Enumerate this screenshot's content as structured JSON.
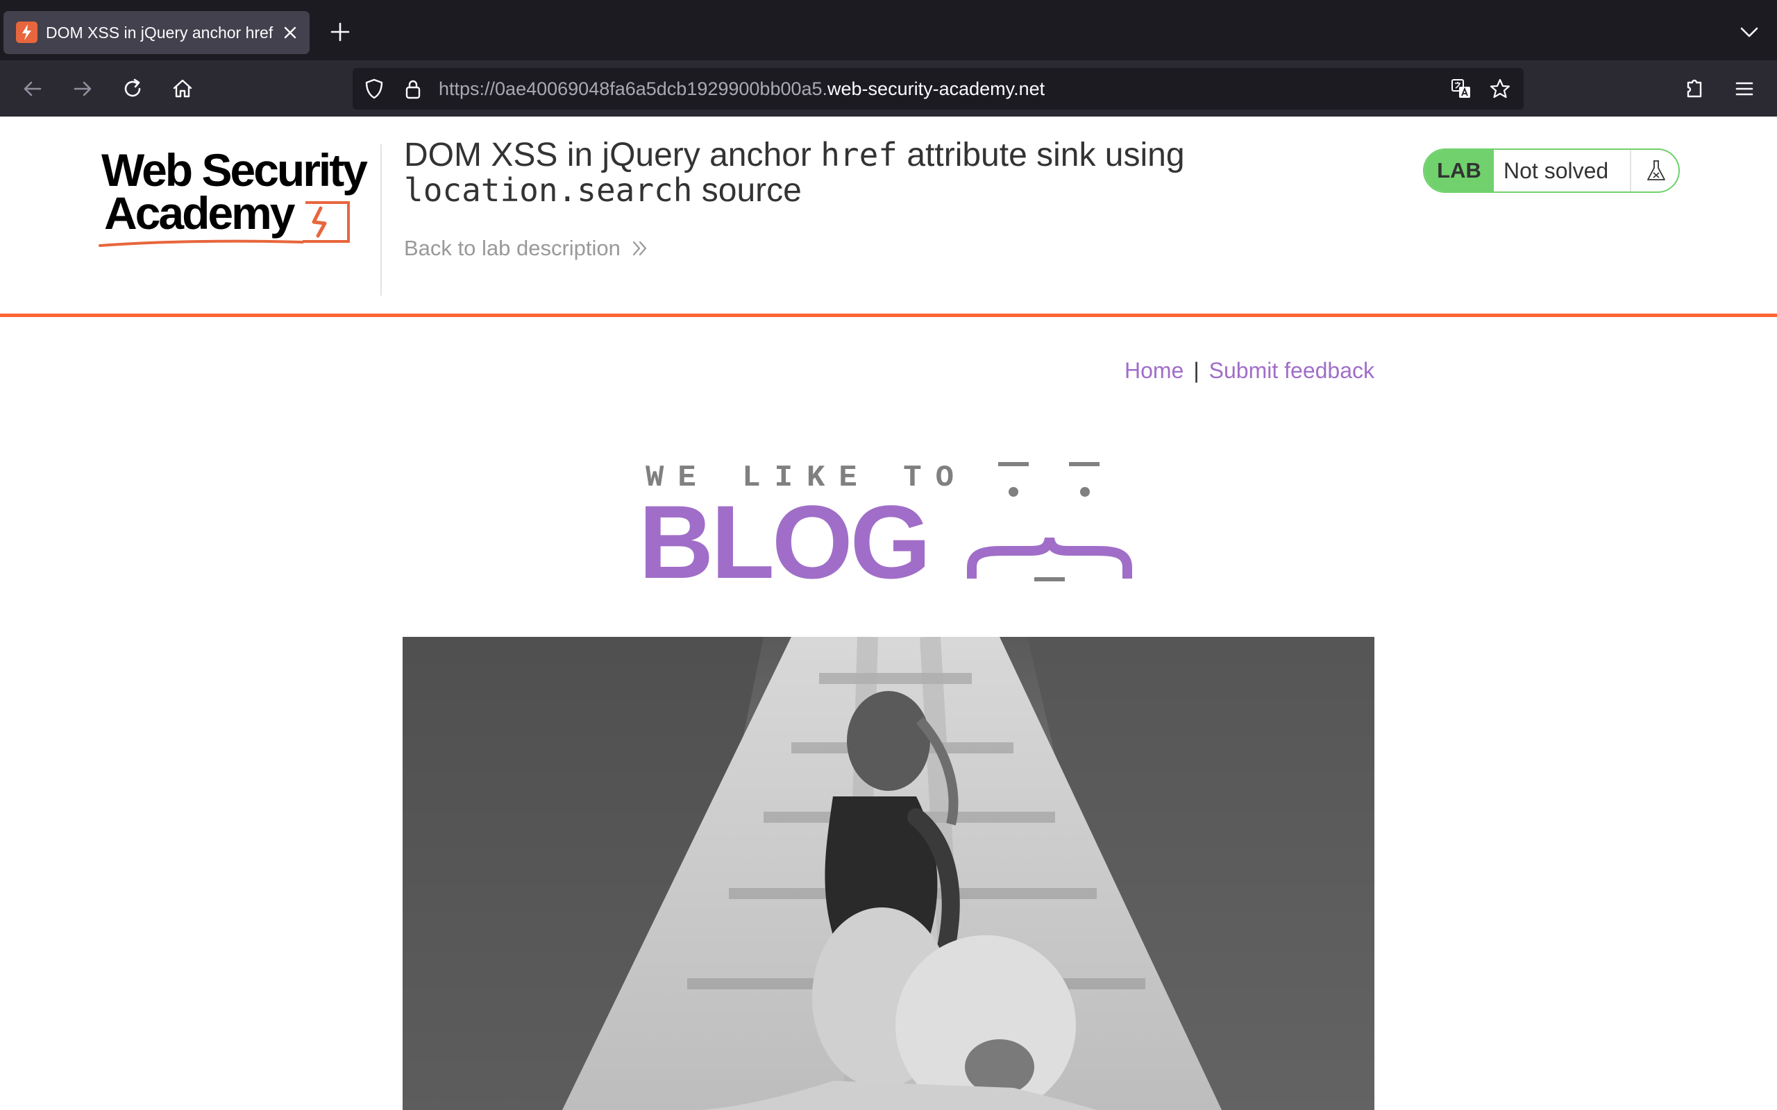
{
  "browser": {
    "tab": {
      "title": "DOM XSS in jQuery anchor href"
    },
    "url": {
      "prefix": "https://0ae40069048fa6a5dcb1929900bb00a5.",
      "host": "web-security-academy.net"
    }
  },
  "header": {
    "logo": {
      "line1": "Web Security",
      "line2": "Academy"
    },
    "title": {
      "part1": "DOM XSS in jQuery anchor ",
      "code1": "href",
      "part2": " attribute sink using",
      "code2": "location.search",
      "part3": " source"
    },
    "back_link": "Back to lab description",
    "lab_status": {
      "badge": "LAB",
      "status": "Not solved"
    }
  },
  "blog": {
    "nav": {
      "home": "Home",
      "separator": "|",
      "feedback": "Submit feedback"
    },
    "banner": {
      "top_text": "WE LIKE TO",
      "main_text": "BLOG"
    }
  },
  "colors": {
    "accent_orange": "#ff6633",
    "lab_green": "#70d16d",
    "link_purple": "#a06ec8"
  }
}
